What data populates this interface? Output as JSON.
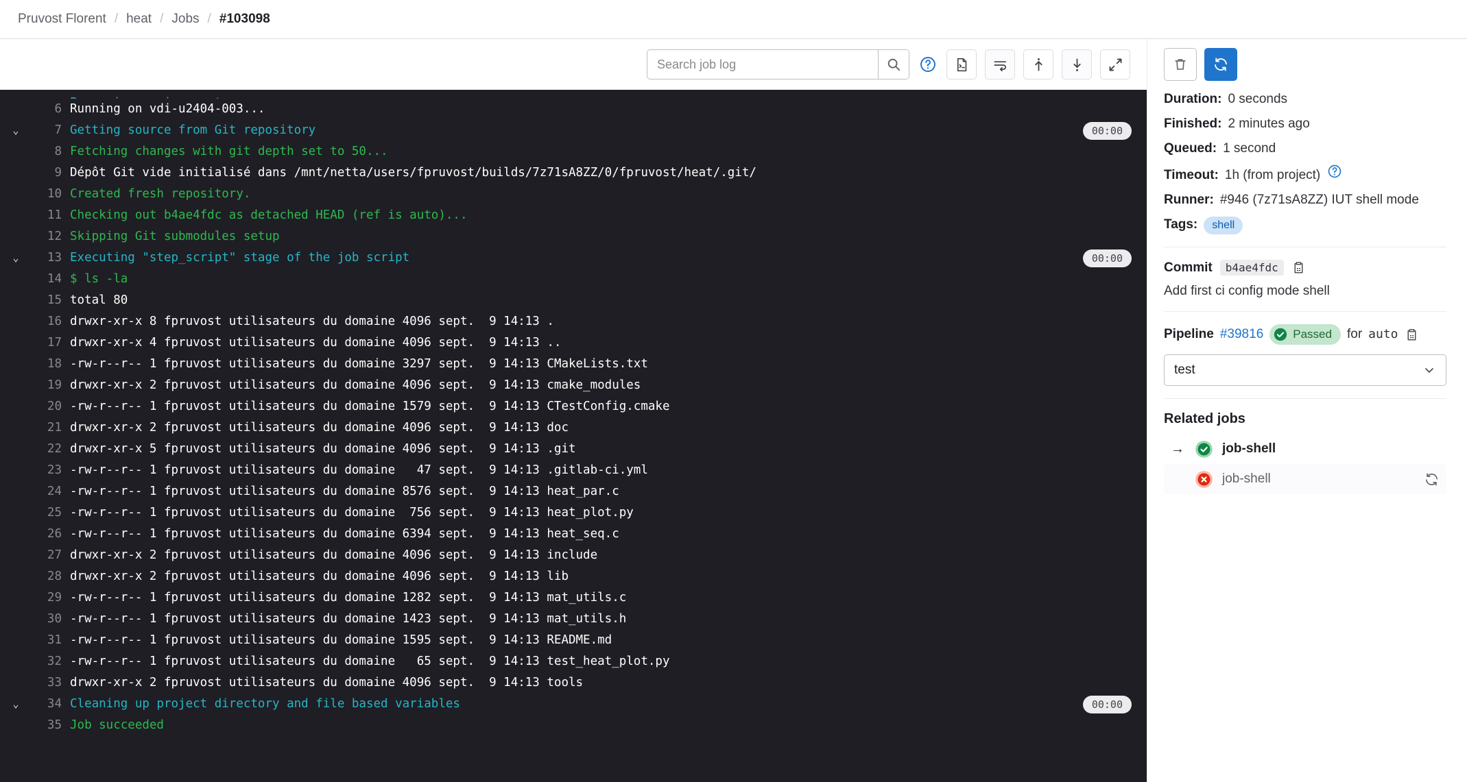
{
  "breadcrumb": {
    "items": [
      {
        "label": "Pruvost Florent",
        "current": false
      },
      {
        "label": "heat",
        "current": false
      },
      {
        "label": "Jobs",
        "current": false
      },
      {
        "label": "#103098",
        "current": true
      }
    ],
    "separator": "/"
  },
  "toolbar": {
    "search_placeholder": "Search job log",
    "search_value": "",
    "search_icon": "search-icon",
    "help_icon": "question-circle-icon",
    "raw_log_icon": "file-terminal-icon",
    "soft_wrap_icon": "soft-wrap-icon",
    "scroll_top_icon": "scroll-to-top-icon",
    "scroll_bottom_icon": "scroll-to-bottom-icon",
    "fullscreen_icon": "expand-icon"
  },
  "sidebar_actions": {
    "erase_icon": "trash-icon",
    "retry_icon": "retry-icon",
    "retry_bg": "#1f75cb"
  },
  "log": {
    "clipped_top_text": "Preparing environment",
    "lines": [
      {
        "n": "6",
        "text": "Running on vdi-u2404-003...",
        "color": "white",
        "toggle": false,
        "duration": null
      },
      {
        "n": "7",
        "text": "Getting source from Git repository",
        "color": "cyan",
        "toggle": true,
        "duration": "00:00"
      },
      {
        "n": "8",
        "text": "Fetching changes with git depth set to 50...",
        "color": "green",
        "toggle": false,
        "duration": null
      },
      {
        "n": "9",
        "text": "Dépôt Git vide initialisé dans /mnt/netta/users/fpruvost/builds/7z71sA8ZZ/0/fpruvost/heat/.git/",
        "color": "white",
        "toggle": false,
        "duration": null
      },
      {
        "n": "10",
        "text": "Created fresh repository.",
        "color": "green",
        "toggle": false,
        "duration": null
      },
      {
        "n": "11",
        "text": "Checking out b4ae4fdc as detached HEAD (ref is auto)...",
        "color": "green",
        "toggle": false,
        "duration": null
      },
      {
        "n": "12",
        "text": "Skipping Git submodules setup",
        "color": "green",
        "toggle": false,
        "duration": null
      },
      {
        "n": "13",
        "text": "Executing \"step_script\" stage of the job script",
        "color": "cyan",
        "toggle": true,
        "duration": "00:00"
      },
      {
        "n": "14",
        "text": "$ ls -la",
        "color": "green",
        "toggle": false,
        "duration": null
      },
      {
        "n": "15",
        "text": "total 80",
        "color": "white",
        "toggle": false,
        "duration": null
      },
      {
        "n": "16",
        "text": "drwxr-xr-x 8 fpruvost utilisateurs du domaine 4096 sept.  9 14:13 .",
        "color": "white",
        "toggle": false,
        "duration": null
      },
      {
        "n": "17",
        "text": "drwxr-xr-x 4 fpruvost utilisateurs du domaine 4096 sept.  9 14:13 ..",
        "color": "white",
        "toggle": false,
        "duration": null
      },
      {
        "n": "18",
        "text": "-rw-r--r-- 1 fpruvost utilisateurs du domaine 3297 sept.  9 14:13 CMakeLists.txt",
        "color": "white",
        "toggle": false,
        "duration": null
      },
      {
        "n": "19",
        "text": "drwxr-xr-x 2 fpruvost utilisateurs du domaine 4096 sept.  9 14:13 cmake_modules",
        "color": "white",
        "toggle": false,
        "duration": null
      },
      {
        "n": "20",
        "text": "-rw-r--r-- 1 fpruvost utilisateurs du domaine 1579 sept.  9 14:13 CTestConfig.cmake",
        "color": "white",
        "toggle": false,
        "duration": null
      },
      {
        "n": "21",
        "text": "drwxr-xr-x 2 fpruvost utilisateurs du domaine 4096 sept.  9 14:13 doc",
        "color": "white",
        "toggle": false,
        "duration": null
      },
      {
        "n": "22",
        "text": "drwxr-xr-x 5 fpruvost utilisateurs du domaine 4096 sept.  9 14:13 .git",
        "color": "white",
        "toggle": false,
        "duration": null
      },
      {
        "n": "23",
        "text": "-rw-r--r-- 1 fpruvost utilisateurs du domaine   47 sept.  9 14:13 .gitlab-ci.yml",
        "color": "white",
        "toggle": false,
        "duration": null
      },
      {
        "n": "24",
        "text": "-rw-r--r-- 1 fpruvost utilisateurs du domaine 8576 sept.  9 14:13 heat_par.c",
        "color": "white",
        "toggle": false,
        "duration": null
      },
      {
        "n": "25",
        "text": "-rw-r--r-- 1 fpruvost utilisateurs du domaine  756 sept.  9 14:13 heat_plot.py",
        "color": "white",
        "toggle": false,
        "duration": null
      },
      {
        "n": "26",
        "text": "-rw-r--r-- 1 fpruvost utilisateurs du domaine 6394 sept.  9 14:13 heat_seq.c",
        "color": "white",
        "toggle": false,
        "duration": null
      },
      {
        "n": "27",
        "text": "drwxr-xr-x 2 fpruvost utilisateurs du domaine 4096 sept.  9 14:13 include",
        "color": "white",
        "toggle": false,
        "duration": null
      },
      {
        "n": "28",
        "text": "drwxr-xr-x 2 fpruvost utilisateurs du domaine 4096 sept.  9 14:13 lib",
        "color": "white",
        "toggle": false,
        "duration": null
      },
      {
        "n": "29",
        "text": "-rw-r--r-- 1 fpruvost utilisateurs du domaine 1282 sept.  9 14:13 mat_utils.c",
        "color": "white",
        "toggle": false,
        "duration": null
      },
      {
        "n": "30",
        "text": "-rw-r--r-- 1 fpruvost utilisateurs du domaine 1423 sept.  9 14:13 mat_utils.h",
        "color": "white",
        "toggle": false,
        "duration": null
      },
      {
        "n": "31",
        "text": "-rw-r--r-- 1 fpruvost utilisateurs du domaine 1595 sept.  9 14:13 README.md",
        "color": "white",
        "toggle": false,
        "duration": null
      },
      {
        "n": "32",
        "text": "-rw-r--r-- 1 fpruvost utilisateurs du domaine   65 sept.  9 14:13 test_heat_plot.py",
        "color": "white",
        "toggle": false,
        "duration": null
      },
      {
        "n": "33",
        "text": "drwxr-xr-x 2 fpruvost utilisateurs du domaine 4096 sept.  9 14:13 tools",
        "color": "white",
        "toggle": false,
        "duration": null
      },
      {
        "n": "34",
        "text": "Cleaning up project directory and file based variables",
        "color": "cyan",
        "toggle": true,
        "duration": "00:00"
      },
      {
        "n": "35",
        "text": "Job succeeded",
        "color": "green",
        "toggle": false,
        "duration": null
      }
    ]
  },
  "details": {
    "duration_label": "Duration:",
    "duration_value": "0 seconds",
    "finished_label": "Finished:",
    "finished_value": "2 minutes ago",
    "queued_label": "Queued:",
    "queued_value": "1 second",
    "timeout_label": "Timeout:",
    "timeout_value": "1h (from project)",
    "timeout_help_icon": "question-circle-icon",
    "runner_label": "Runner:",
    "runner_value": "#946 (7z71sA8ZZ) IUT shell mode",
    "tags_label": "Tags:",
    "tags": [
      "shell"
    ]
  },
  "commit": {
    "label": "Commit",
    "sha": "b4ae4fdc",
    "copy_icon": "copy-icon",
    "message": "Add first ci config mode shell"
  },
  "pipeline": {
    "label": "Pipeline",
    "id": "#39816",
    "status": "Passed",
    "status_icon": "status-success-icon",
    "for_text": "for",
    "ref": "auto",
    "copy_icon": "copy-icon",
    "stage_selected": "test",
    "stage_chevron_icon": "chevron-down-icon"
  },
  "related_jobs": {
    "title": "Related jobs",
    "jobs": [
      {
        "name": "job-shell",
        "status": "success",
        "current": true,
        "arrow": "→",
        "retry_icon": null
      },
      {
        "name": "job-shell",
        "status": "failed",
        "current": false,
        "arrow": "",
        "retry_icon": "retry-icon"
      }
    ]
  },
  "colors": {
    "accent": "#1f75cb",
    "success": "#108548",
    "failed": "#dd2b0e",
    "log_bg": "#1f1e24"
  }
}
